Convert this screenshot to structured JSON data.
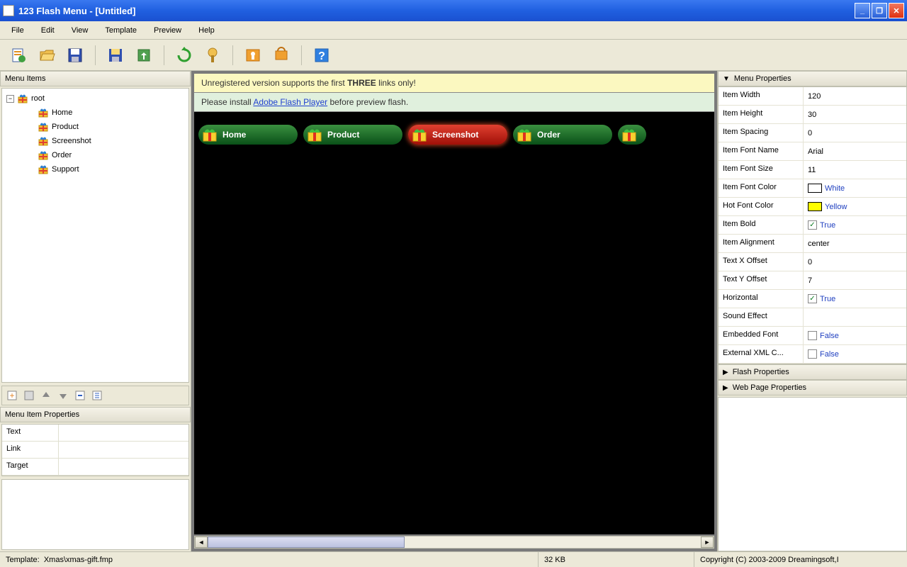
{
  "app": {
    "title": "123 Flash Menu - [Untitled]"
  },
  "menubar": [
    "File",
    "Edit",
    "View",
    "Template",
    "Preview",
    "Help"
  ],
  "toolbar_icons": [
    "new",
    "open",
    "save",
    "save-template",
    "export",
    "refresh",
    "publish",
    "key",
    "cart",
    "help"
  ],
  "left": {
    "panel_title": "Menu Items",
    "root": "root",
    "items": [
      "Home",
      "Product",
      "Screenshot",
      "Order",
      "Support"
    ],
    "item_props_title": "Menu Item Properties",
    "item_prop_rows": [
      "Text",
      "Link",
      "Target"
    ]
  },
  "preview": {
    "banner1_pre": "Unregistered version supports the first ",
    "banner1_bold": "THREE",
    "banner1_post": " links only!",
    "banner2_pre": "Please install ",
    "banner2_link": "Adobe Flash Player",
    "banner2_post": " before preview flash.",
    "menu_buttons": [
      "Home",
      "Product",
      "Screenshot",
      "Order"
    ],
    "hot_index": 2
  },
  "right": {
    "sections": [
      "Menu Properties",
      "Flash Properties",
      "Web Page Properties"
    ],
    "props": [
      {
        "k": "Item Width",
        "v": "120",
        "type": "text"
      },
      {
        "k": "Item Height",
        "v": "30",
        "type": "text"
      },
      {
        "k": "Item Spacing",
        "v": "0",
        "type": "text"
      },
      {
        "k": "Item Font Name",
        "v": "Arial",
        "type": "text"
      },
      {
        "k": "Item Font Size",
        "v": "11",
        "type": "text"
      },
      {
        "k": "Item Font Color",
        "v": "White",
        "type": "color",
        "color": "#ffffff"
      },
      {
        "k": "Hot Font Color",
        "v": "Yellow",
        "type": "color",
        "color": "#ffff00"
      },
      {
        "k": "Item Bold",
        "v": "True",
        "type": "check",
        "checked": true
      },
      {
        "k": "Item Alignment",
        "v": "center",
        "type": "text"
      },
      {
        "k": "Text X Offset",
        "v": "0",
        "type": "text"
      },
      {
        "k": "Text Y Offset",
        "v": "7",
        "type": "text"
      },
      {
        "k": "Horizontal",
        "v": "True",
        "type": "check",
        "checked": true
      },
      {
        "k": "Sound Effect",
        "v": "",
        "type": "text"
      },
      {
        "k": "Embedded Font",
        "v": "False",
        "type": "check",
        "checked": false
      },
      {
        "k": "External XML C...",
        "v": "False",
        "type": "check",
        "checked": false
      }
    ]
  },
  "status": {
    "template_label": "Template:",
    "template_value": "Xmas\\xmas-gift.fmp",
    "size": "32 KB",
    "copyright": "Copyright (C) 2003-2009 Dreamingsoft,I"
  }
}
